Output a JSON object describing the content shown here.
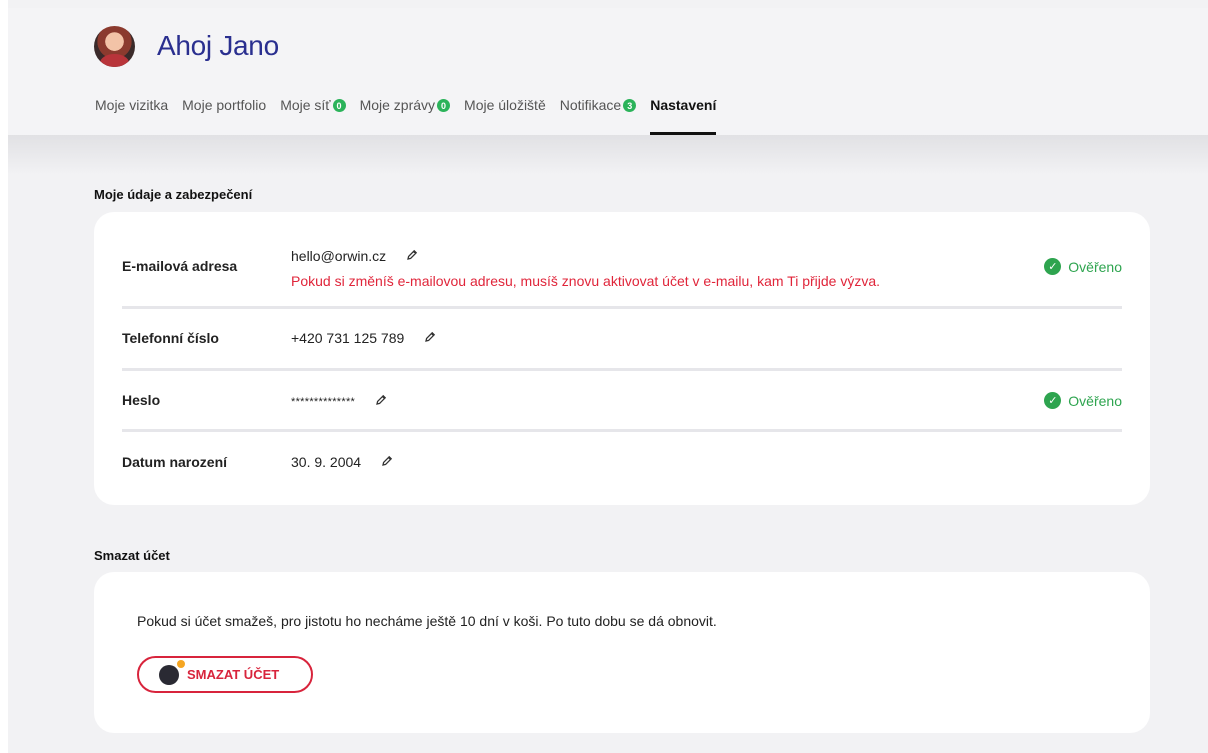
{
  "header": {
    "greeting": "Ahoj Jano",
    "nav": [
      {
        "label": "Moje vizitka",
        "badge": null,
        "active": false
      },
      {
        "label": "Moje portfolio",
        "badge": null,
        "active": false
      },
      {
        "label": "Moje síť",
        "badge": "0",
        "active": false
      },
      {
        "label": "Moje zprávy",
        "badge": "0",
        "active": false
      },
      {
        "label": "Moje úložiště",
        "badge": null,
        "active": false
      },
      {
        "label": "Notifikace",
        "badge": "3",
        "active": false
      },
      {
        "label": "Nastavení",
        "badge": null,
        "active": true
      }
    ]
  },
  "account": {
    "title": "Moje údaje a zabezpečení",
    "email": {
      "label": "E-mailová adresa",
      "value": "hello@orwin.cz",
      "warning": "Pokud si změníš e-mailovou adresu, musíš znovu aktivovat účet v e-mailu, kam Ti přijde výzva.",
      "status": "Ověřeno"
    },
    "phone": {
      "label": "Telefonní číslo",
      "value": "+420 731 125 789"
    },
    "password": {
      "label": "Heslo",
      "value": "**************",
      "status": "Ověřeno"
    },
    "birthdate": {
      "label": "Datum narození",
      "value": "30. 9. 2004"
    }
  },
  "delete": {
    "title": "Smazat účet",
    "text": "Pokud si účet smažeš, pro jistotu ho necháme ještě 10 dní v koši. Po tuto dobu se dá obnovit.",
    "button": "SMAZAT ÚČET"
  },
  "colors": {
    "accent": "#2a2f8f",
    "danger": "#d8243c",
    "success": "#2ea44f"
  },
  "icons": {
    "edit": "pencil-icon",
    "verified": "check-circle-icon",
    "delete": "bomb-icon"
  }
}
